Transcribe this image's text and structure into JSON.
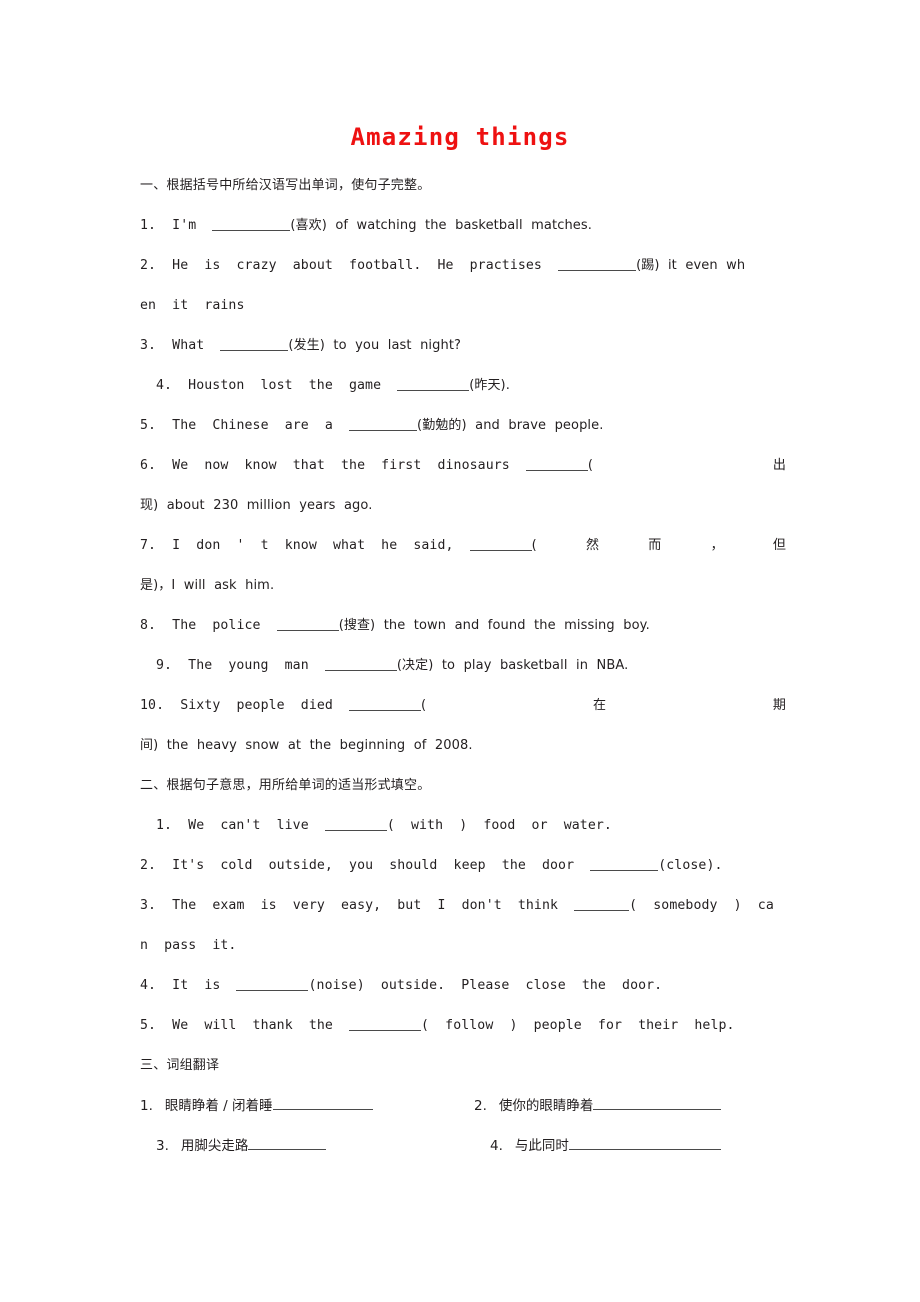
{
  "document": {
    "title": "Amazing things",
    "title_color": "#ee1111",
    "background_color": "#ffffff",
    "text_color": "#231f20"
  },
  "sections": [
    {
      "heading": "一、根据括号中所给汉语写出单词，使句子完整。",
      "items": [
        {
          "number": "1.",
          "lines": [
            {
              "pre": "1.  I'm  ",
              "blank": 78,
              "post": "(喜欢)  of  watching  the  basketball  matches."
            }
          ]
        },
        {
          "number": "2.",
          "lines": [
            {
              "pre": "2.  He  is  crazy  about  football.  He  practises  ",
              "blank": 78,
              "post": "(踢)  it  even  wh"
            },
            {
              "pre": "en  it  rains",
              "blank": 0,
              "post": ""
            }
          ]
        },
        {
          "number": "3.",
          "lines": [
            {
              "pre": "3.  What  ",
              "blank": 68,
              "post": "(发生)  to  you  last  night?"
            }
          ]
        },
        {
          "number": "4.",
          "lines": [
            {
              "pre": "4.  Houston  lost  the  game  ",
              "blank": 72,
              "post": "(昨天)."
            }
          ]
        },
        {
          "number": "5.",
          "lines": [
            {
              "pre": "5.  The  Chinese  are  a  ",
              "blank": 68,
              "post": "(勤勉的)  and  brave  people."
            }
          ]
        },
        {
          "number": "6.",
          "lines": [
            {
              "pre": "6.  We  now  know  that  the  first  dinosaurs  ",
              "blank": 62,
              "post": "(",
              "tail": "出"
            },
            {
              "pre": "现)  about  230  million  years  ago.",
              "blank": 0,
              "post": ""
            }
          ]
        },
        {
          "number": "7.",
          "lines": [
            {
              "pre": "7.  I  don  '  t  know  what  he  said,  ",
              "blank": 62,
              "post": "(",
              "mid": [
                "然",
                "而",
                "，"
              ],
              "tail": "但"
            },
            {
              "pre": "是)，I  will  ask  him.",
              "blank": 0,
              "post": ""
            }
          ]
        },
        {
          "number": "8.",
          "lines": [
            {
              "pre": "8.  The  police  ",
              "blank": 62,
              "post": "(搜查)  the  town  and  found  the  missing  boy."
            }
          ]
        },
        {
          "number": "9.",
          "lines": [
            {
              "pre": "9.  The  young  man  ",
              "blank": 72,
              "post": "(决定)  to  play  basketball  in  NBA."
            }
          ]
        },
        {
          "number": "10.",
          "lines": [
            {
              "pre": "10.  Sixty  people  died  ",
              "blank": 72,
              "post": "(",
              "mid": [
                "在"
              ],
              "tail": "期"
            },
            {
              "pre": "间)  the  heavy  snow  at  the  beginning  of  2008.",
              "blank": 0,
              "post": ""
            }
          ]
        }
      ]
    },
    {
      "heading": "二、根据句子意思，用所给单词的适当形式填空。",
      "items": [
        {
          "number": "1.",
          "lines": [
            {
              "pre": "1.  We  can't  live  ",
              "blank": 62,
              "post": "(  with  )  food  or  water."
            }
          ]
        },
        {
          "number": "2.",
          "lines": [
            {
              "pre": "2.  It's  cold  outside,  you  should  keep  the  door  ",
              "blank": 68,
              "post": "(close)."
            }
          ]
        },
        {
          "number": "3.",
          "lines": [
            {
              "pre": "3.  The  exam  is  very  easy,  but  I  don't  think  ",
              "blank": 55,
              "post": "(  somebody  )  ca"
            },
            {
              "pre": "n  pass  it.",
              "blank": 0,
              "post": ""
            }
          ]
        },
        {
          "number": "4.",
          "lines": [
            {
              "pre": "4.  It  is  ",
              "blank": 72,
              "post": "(noise)  outside.  Please  close  the  door."
            }
          ]
        },
        {
          "number": "5.",
          "lines": [
            {
              "pre": "5.  We  will  thank  the  ",
              "blank": 72,
              "post": "(  follow  )  people  for  their  help."
            }
          ]
        }
      ]
    },
    {
      "heading": "三、词组翻译",
      "phrase_rows": [
        {
          "indent": false,
          "cells": [
            {
              "number": "1.",
              "text": "眼睛睁着 / 闭着睡",
              "line_width": 100
            },
            {
              "number": "2.",
              "text": "使你的眼睛睁着",
              "line_width": 128
            }
          ]
        },
        {
          "indent": true,
          "cells": [
            {
              "number": "3.",
              "text": "用脚尖走路",
              "line_width": 78
            },
            {
              "number": "4.",
              "text": "与此同时",
              "line_width": 152
            }
          ]
        }
      ]
    }
  ]
}
